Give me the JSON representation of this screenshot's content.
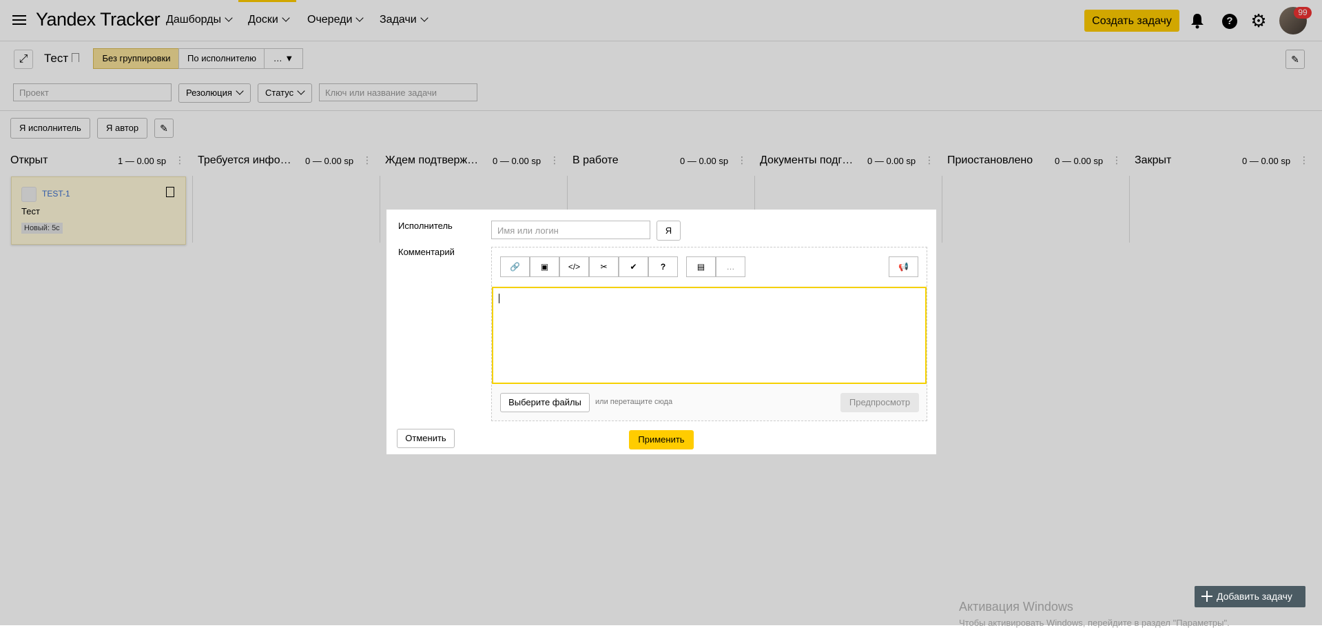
{
  "topbar": {
    "logo": "Yandex Tracker",
    "nav": [
      "Дашборды",
      "Доски",
      "Очереди",
      "Задачи"
    ],
    "create_label": "Создать задачу",
    "help_label": "?",
    "notification_count": "99",
    "accent_color": "#ffcc00"
  },
  "board": {
    "title": "Тест",
    "grouping": [
      "Без группировки",
      "По исполнителю",
      "… ▼"
    ],
    "filters": {
      "project_placeholder": "Проект",
      "resolution_label": "Резолюция",
      "status_label": "Статус",
      "search_placeholder": "Ключ или название задачи"
    },
    "quick_filters": [
      "Я исполнитель",
      "Я автор"
    ]
  },
  "columns": [
    {
      "name": "Открыт",
      "count": "1 — 0.00 sp"
    },
    {
      "name": "Требуется инфо…",
      "count": "0 — 0.00 sp"
    },
    {
      "name": "Ждем подтверж…",
      "count": "0 — 0.00 sp"
    },
    {
      "name": "В работе",
      "count": "0 — 0.00 sp"
    },
    {
      "name": "Документы подг…",
      "count": "0 — 0.00 sp"
    },
    {
      "name": "Приостановлено",
      "count": "0 — 0.00 sp"
    },
    {
      "name": "Закрыт",
      "count": "0 — 0.00 sp"
    }
  ],
  "card": {
    "key": "TEST-1",
    "title": "Тест",
    "tag": "Новый: 5с"
  },
  "dialog": {
    "assignee_label": "Исполнитель",
    "assignee_placeholder": "Имя или логин",
    "me_label": "Я",
    "comment_label": "Комментарий",
    "tools_more": "…",
    "help_tool": "?",
    "file_button": "Выберите файлы",
    "drop_hint": "или перетащите сюда",
    "preview_label": "Предпросмотр",
    "cancel_label": "Отменить",
    "apply_label": "Применить"
  },
  "add_task_label": "Добавить задачу",
  "watermark": {
    "line1": "Активация Windows",
    "line2": "Чтобы активировать Windows, перейдите в раздел \"Параметры\"."
  }
}
